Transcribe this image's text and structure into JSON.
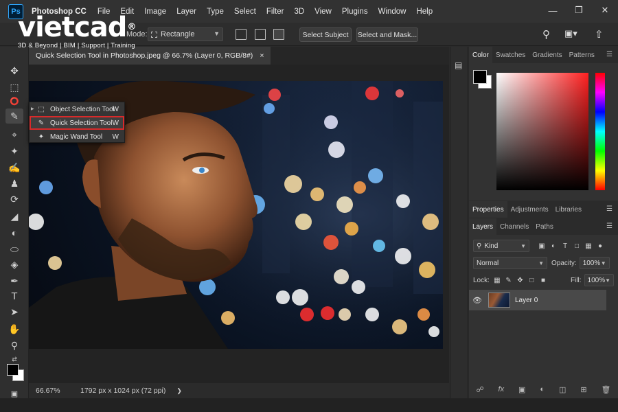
{
  "app": {
    "logo_text": "Ps",
    "title": "Photoshop CC",
    "menu": [
      "File",
      "Edit",
      "Image",
      "Layer",
      "Type",
      "Select",
      "Filter",
      "3D",
      "View",
      "Plugins",
      "Window",
      "Help"
    ]
  },
  "watermark": {
    "logo": "vietcad",
    "registered": "®",
    "tagline": "3D & Beyond | BIM | Support | Training"
  },
  "options": {
    "mode_label": "Mode:",
    "mode_value": "Rectangle",
    "select_subject": "Select Subject",
    "select_mask": "Select and Mask..."
  },
  "document": {
    "tab_title": "Quick Selection Tool in Photoshop.jpeg @ 66.7% (Layer 0, RGB/8#)",
    "tab_close": "×",
    "zoom": "66.67%",
    "info": "1792 px x 1024 px (72 ppi)"
  },
  "flyout": {
    "items": [
      {
        "label": "Object Selection Tool",
        "key": "W"
      },
      {
        "label": "Quick Selection Tool",
        "key": "W"
      },
      {
        "label": "Magic Wand Tool",
        "key": "W"
      }
    ]
  },
  "color_panel": {
    "tabs": [
      "Color",
      "Swatches",
      "Gradients",
      "Patterns"
    ],
    "foreground": "#000000",
    "background": "#ffffff"
  },
  "properties_panel": {
    "tabs": [
      "Properties",
      "Adjustments",
      "Libraries"
    ]
  },
  "layers_panel": {
    "tabs": [
      "Layers",
      "Channels",
      "Paths"
    ],
    "filter": "Kind",
    "blend_mode": "Normal",
    "opacity_label": "Opacity:",
    "opacity": "100%",
    "lock_label": "Lock:",
    "fill_label": "Fill:",
    "fill": "100%",
    "layers": [
      {
        "name": "Layer 0",
        "visible": true
      }
    ]
  }
}
